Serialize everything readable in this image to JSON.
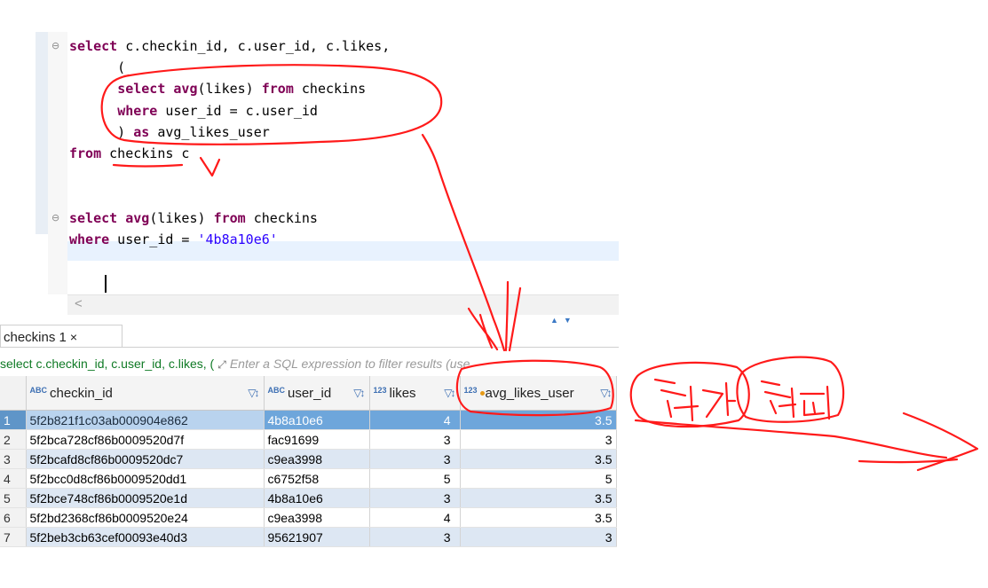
{
  "editor": {
    "lines": [
      {
        "segments": [
          {
            "t": "select",
            "c": "kw"
          },
          {
            "t": " c.checkin_id, c.user_id, c.likes,",
            "c": ""
          }
        ],
        "fold": true
      },
      {
        "segments": [
          {
            "t": "      (",
            "c": ""
          }
        ]
      },
      {
        "segments": [
          {
            "t": "      ",
            "c": ""
          },
          {
            "t": "select",
            "c": "kw"
          },
          {
            "t": " ",
            "c": ""
          },
          {
            "t": "avg",
            "c": "kw"
          },
          {
            "t": "(likes) ",
            "c": ""
          },
          {
            "t": "from",
            "c": "kw"
          },
          {
            "t": " checkins",
            "c": ""
          }
        ]
      },
      {
        "segments": [
          {
            "t": "      ",
            "c": ""
          },
          {
            "t": "where",
            "c": "kw"
          },
          {
            "t": " user_id = c.user_id",
            "c": ""
          }
        ]
      },
      {
        "segments": [
          {
            "t": "      ) ",
            "c": ""
          },
          {
            "t": "as",
            "c": "kw"
          },
          {
            "t": " avg_likes_user",
            "c": ""
          }
        ]
      },
      {
        "segments": [
          {
            "t": "from",
            "c": "kw"
          },
          {
            "t": " checkins c",
            "c": ""
          }
        ]
      },
      {
        "segments": []
      },
      {
        "segments": []
      },
      {
        "segments": [
          {
            "t": "select",
            "c": "kw"
          },
          {
            "t": " ",
            "c": ""
          },
          {
            "t": "avg",
            "c": "kw"
          },
          {
            "t": "(likes) ",
            "c": ""
          },
          {
            "t": "from",
            "c": "kw"
          },
          {
            "t": " checkins",
            "c": ""
          }
        ],
        "fold": true
      },
      {
        "segments": [
          {
            "t": "where",
            "c": "kw"
          },
          {
            "t": " user_id = ",
            "c": ""
          },
          {
            "t": "'4b8a10e6'",
            "c": "str"
          }
        ]
      }
    ],
    "scroll_left_glyph": "<"
  },
  "results_tab": {
    "label": "checkins 1",
    "close": "×"
  },
  "filter": {
    "query_text": "select c.checkin_id, c.user_id, c.likes, (",
    "placeholder": "Enter a SQL expression to filter results (use"
  },
  "grid": {
    "columns": [
      {
        "name": "checkin_id",
        "type": "ABC"
      },
      {
        "name": "user_id",
        "type": "ABC"
      },
      {
        "name": "likes",
        "type": "123"
      },
      {
        "name": "avg_likes_user",
        "type": "123"
      }
    ],
    "rows": [
      {
        "n": "1",
        "checkin_id": "5f2b821f1c03ab000904e862",
        "user_id": "4b8a10e6",
        "likes": "4",
        "avg_likes_user": "3.5"
      },
      {
        "n": "2",
        "checkin_id": "5f2bca728cf86b0009520d7f",
        "user_id": "fac91699",
        "likes": "3",
        "avg_likes_user": "3"
      },
      {
        "n": "3",
        "checkin_id": "5f2bcafd8cf86b0009520dc7",
        "user_id": "c9ea3998",
        "likes": "3",
        "avg_likes_user": "3.5"
      },
      {
        "n": "4",
        "checkin_id": "5f2bcc0d8cf86b0009520dd1",
        "user_id": "c6752f58",
        "likes": "5",
        "avg_likes_user": "5"
      },
      {
        "n": "5",
        "checkin_id": "5f2bce748cf86b0009520e1d",
        "user_id": "4b8a10e6",
        "likes": "3",
        "avg_likes_user": "3.5"
      },
      {
        "n": "6",
        "checkin_id": "5f2bd2368cf86b0009520e24",
        "user_id": "c9ea3998",
        "likes": "4",
        "avg_likes_user": "3.5"
      },
      {
        "n": "7",
        "checkin_id": "5f2beb3cb63cef00093e40d3",
        "user_id": "95621907",
        "likes": "3",
        "avg_likes_user": "3"
      }
    ]
  },
  "annotation": {
    "handwriting": "최대 최소",
    "ink_color": "#ff1a1a"
  }
}
